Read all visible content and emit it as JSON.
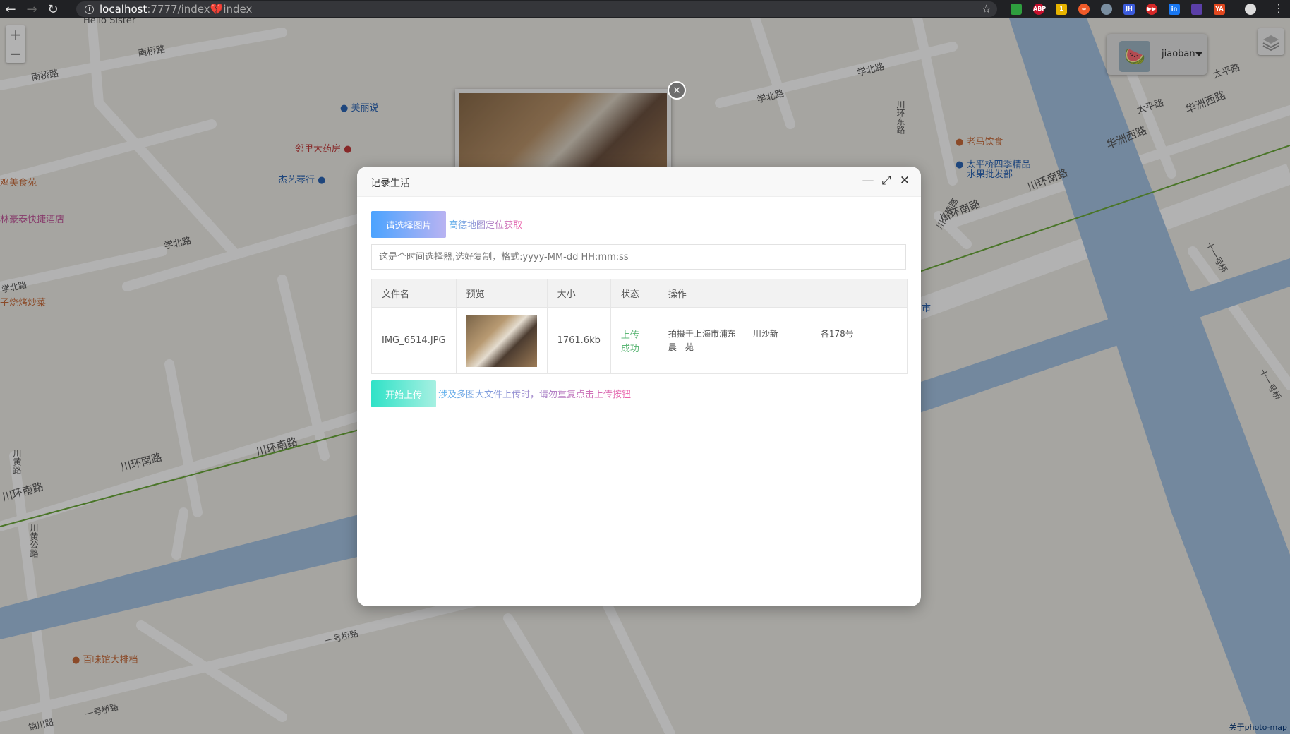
{
  "browser": {
    "url_host": "localhost",
    "url_rest": ":7777/index",
    "url_emoji": "💔",
    "url_tail": "index",
    "extensions": [
      "ABP",
      "1",
      "∞",
      "JH",
      "▶▶",
      "in",
      "YA"
    ]
  },
  "map": {
    "zoom_in": "+",
    "zoom_out": "−",
    "labels": {
      "l1": "Hello Sister",
      "l2": "南桥路",
      "l3": "南桥路",
      "l4": "学北路",
      "l5": "学北路",
      "l6": "学北路",
      "l7": "太平路",
      "l8": "太平路",
      "l9": "华洲西路",
      "l10": "华洲西路",
      "l11": "川环南路",
      "l12": "川环南路",
      "l13": "川环南路",
      "l14": "川环南路",
      "l15": "川环南路",
      "l16": "川环东路",
      "l17": "川乐南路",
      "l18": "一号桥路",
      "l19": "一号桥路",
      "l20": "川黄路",
      "l21": "川黄公路",
      "l22": "十一号桥",
      "l23": "十一号桥",
      "l24": "锦川路",
      "l25": "学北路"
    },
    "pois": {
      "p1": "美丽说",
      "p2": "邻里大药房",
      "p3": "杰艺琴行",
      "p4": "鸡美食苑",
      "p5": "林豪泰快捷酒店",
      "p6": "子烧烤炒菜",
      "p7": "老马饮食",
      "p8": "太平桥四季精品",
      "p9": "水果批发部",
      "p10": "百味馆大排档",
      "p11": "市"
    },
    "credit": "关于photo-map"
  },
  "user": {
    "name": "jiaoban",
    "avatar": "🍉"
  },
  "photo_popup": {
    "close": "×"
  },
  "dialog": {
    "title": "记录生活",
    "minimize": "—",
    "maximize": "⤢",
    "close": "✕",
    "pick_button": "请选择图片",
    "amap_tip": "高德地图定位获取",
    "time_placeholder": "这是个时间选择器,选好复制，格式:yyyy-MM-dd HH:mm:ss",
    "table": {
      "headers": [
        "文件名",
        "预览",
        "大小",
        "状态",
        "操作"
      ],
      "rows": [
        {
          "filename": "IMG_6514.JPG",
          "size": "1761.6kb",
          "status": "上传成功",
          "action_line1": "拍摄于上海市浦东　　川沙新　　　　　各178号",
          "action_line2": "晨　苑"
        }
      ]
    },
    "upload_button": "开始上传",
    "warning": "涉及多图大文件上传时，请勿重复点击上传按钮"
  }
}
